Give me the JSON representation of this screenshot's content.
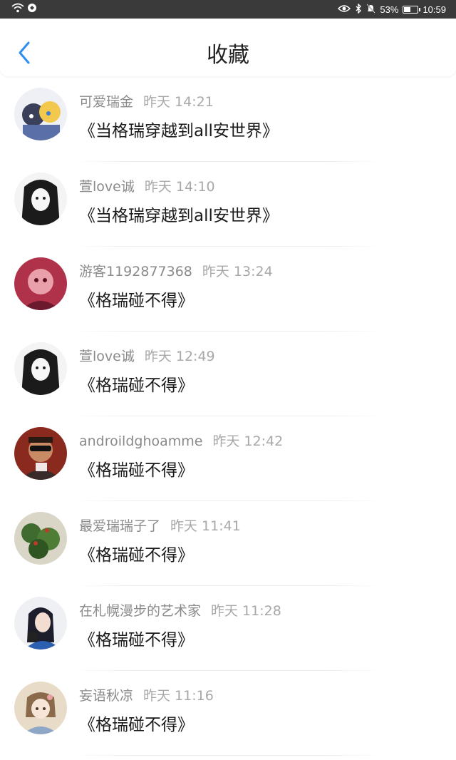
{
  "status_bar": {
    "battery": "53%",
    "time": "10:59",
    "battery_level": 0.53
  },
  "header": {
    "title": "收藏",
    "back_icon": "chevron-left-icon",
    "accent": "#2c8df2"
  },
  "favorites": [
    {
      "user": "可爱瑞金",
      "time": "昨天 14:21",
      "title": "《当格瑞穿越到all安世界》"
    },
    {
      "user": "萱love诚",
      "time": "昨天 14:10",
      "title": "《当格瑞穿越到all安世界》"
    },
    {
      "user": "游客1192877368",
      "time": "昨天 13:24",
      "title": "《格瑞碰不得》"
    },
    {
      "user": "萱love诚",
      "time": "昨天 12:49",
      "title": "《格瑞碰不得》"
    },
    {
      "user": "androildghoamme",
      "time": "昨天 12:42",
      "title": "《格瑞碰不得》"
    },
    {
      "user": "最爱瑞瑞子了",
      "time": "昨天 11:41",
      "title": "《格瑞碰不得》"
    },
    {
      "user": "在札幌漫步的艺术家",
      "time": "昨天 11:28",
      "title": "《格瑞碰不得》"
    },
    {
      "user": "妄语秋凉",
      "time": "昨天 11:16",
      "title": "《格瑞碰不得》"
    }
  ]
}
